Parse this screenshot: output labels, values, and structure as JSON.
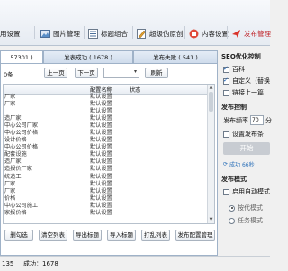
{
  "toolbar": {
    "items": [
      {
        "label": "用设置",
        "icon": "settings-icon"
      },
      {
        "label": "图片管理",
        "icon": "image-icon"
      },
      {
        "label": "标题组合",
        "icon": "list-icon"
      },
      {
        "label": "超级伪原创",
        "icon": "edit-icon"
      },
      {
        "label": "内容设置",
        "icon": "content-icon"
      },
      {
        "label": "发布管理",
        "icon": "publish-icon",
        "active": true
      }
    ]
  },
  "tabs": [
    {
      "label": "57301 )"
    },
    {
      "label": "发表成功 ( 1678 )"
    },
    {
      "label": "发布失败 ( 541 )"
    }
  ],
  "nav": {
    "count_label": "0条",
    "prev_label": "上一页",
    "next_label": "下一页",
    "refresh_label": "刷新"
  },
  "grid": {
    "headers": [
      "配置名称",
      "状态"
    ],
    "rows": [
      {
        "title": "厂家",
        "config": "默认设置"
      },
      {
        "title": "厂家",
        "config": "默认设置"
      },
      {
        "title": "",
        "config": "默认设置"
      },
      {
        "title": "造厂家",
        "config": "默认设置"
      },
      {
        "title": "中心公司厂家",
        "config": "默认设置"
      },
      {
        "title": "中心公司价格",
        "config": "默认设置"
      },
      {
        "title": "设计价格",
        "config": "默认设置"
      },
      {
        "title": "中心公司价格",
        "config": "默认设置"
      },
      {
        "title": "配套设施",
        "config": "默认设置"
      },
      {
        "title": "造厂家",
        "config": "默认设置"
      },
      {
        "title": "造报价厂家",
        "config": "默认设置"
      },
      {
        "title": "统造工",
        "config": "默认设置"
      },
      {
        "title": "厂家",
        "config": "默认设置"
      },
      {
        "title": "厂家",
        "config": "默认设置"
      },
      {
        "title": "价格",
        "config": "默认设置"
      },
      {
        "title": "中心公司施工",
        "config": "默认设置"
      },
      {
        "title": "家报价格",
        "config": "默认设置"
      }
    ]
  },
  "bottom": {
    "buttons": [
      "删勾选",
      "清空列表",
      "导出标题",
      "导入标题",
      "打乱列表",
      "发布配置管理"
    ]
  },
  "right": {
    "seo_heading": "SEO优化控制",
    "opt_baidu": "百科",
    "opt_custom": "自定义（替换",
    "opt_link": "链接上一篇",
    "publish_heading": "发布控制",
    "freq_label": "发布频率",
    "freq_value": "70",
    "freq_unit": "分",
    "opt_schedule": "设置发布条",
    "start_label": "开始",
    "success_text": "成功 66秒",
    "mode_heading": "发布模式",
    "opt_auto": "启用自动模式",
    "mode_rotate": "按代模式",
    "mode_task": "任务模式"
  },
  "status": {
    "left_value": "135",
    "success_label": "成功：1678"
  }
}
